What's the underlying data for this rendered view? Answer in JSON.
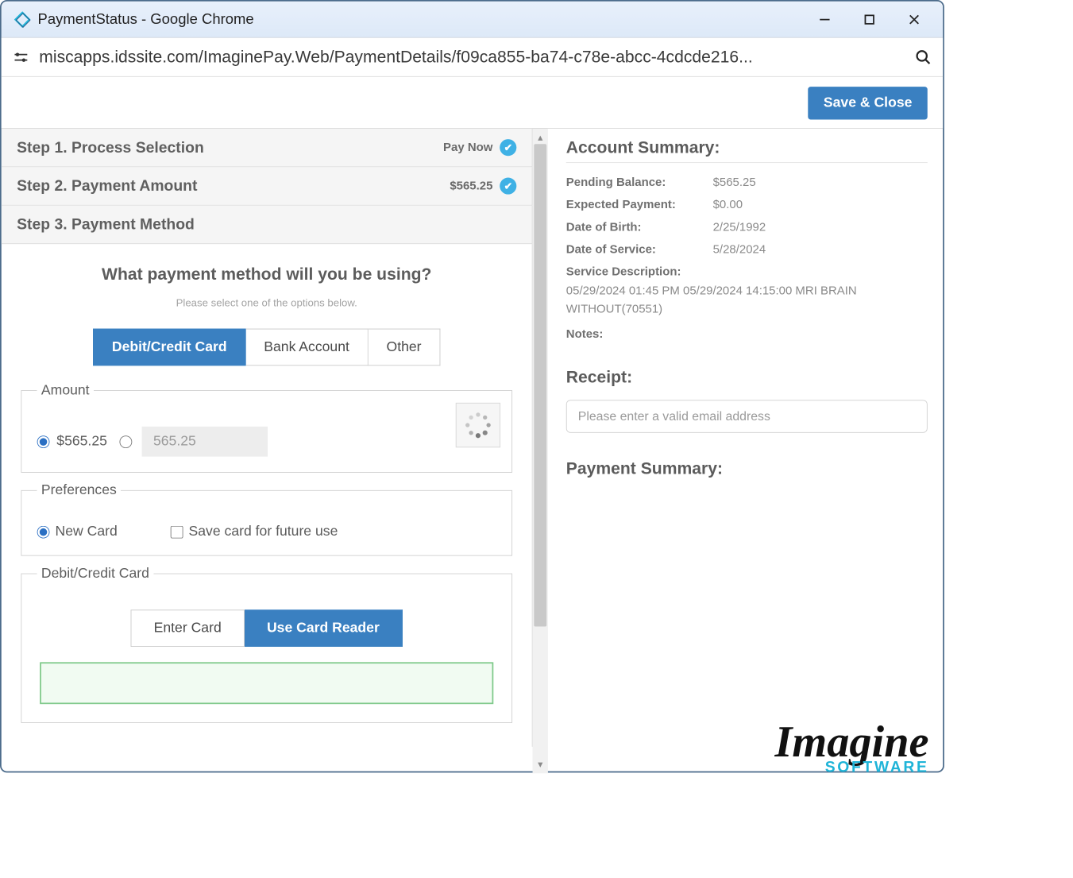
{
  "window": {
    "title": "PaymentStatus - Google Chrome"
  },
  "address": {
    "url": "miscapps.idssite.com/ImaginePay.Web/PaymentDetails/f09ca855-ba74-c78e-abcc-4cdcde216..."
  },
  "topbar": {
    "save_close": "Save & Close"
  },
  "steps": {
    "s1": {
      "title": "Step 1. Process Selection",
      "value": "Pay Now"
    },
    "s2": {
      "title": "Step 2. Payment Amount",
      "value": "$565.25"
    },
    "s3": {
      "title": "Step 3. Payment Method"
    }
  },
  "method": {
    "question": "What payment method will you be using?",
    "subtext": "Please select one of the options below.",
    "tabs": {
      "card": "Debit/Credit Card",
      "bank": "Bank Account",
      "other": "Other"
    }
  },
  "amount": {
    "legend": "Amount",
    "preset_label": "$565.25",
    "custom_value": "565.25"
  },
  "prefs": {
    "legend": "Preferences",
    "new_card": "New Card",
    "save_future": "Save card for future use"
  },
  "cardsec": {
    "legend": "Debit/Credit Card",
    "enter": "Enter Card",
    "reader": "Use Card Reader"
  },
  "summary": {
    "heading": "Account Summary:",
    "rows": {
      "pending_k": "Pending Balance:",
      "pending_v": "$565.25",
      "expected_k": "Expected Payment:",
      "expected_v": "$0.00",
      "dob_k": "Date of Birth:",
      "dob_v": "2/25/1992",
      "dos_k": "Date of Service:",
      "dos_v": "5/28/2024"
    },
    "svc_label": "Service Description:",
    "svc_value": "05/29/2024 01:45 PM   05/29/2024 14:15:00 MRI BRAIN WITHOUT(70551)",
    "notes_label": "Notes:"
  },
  "receipt": {
    "heading": "Receipt:",
    "placeholder": "Please enter a valid email address"
  },
  "paysum": {
    "heading": "Payment Summary:"
  },
  "logo": {
    "main": "Imagine",
    "sub": "SOFTWARE"
  }
}
